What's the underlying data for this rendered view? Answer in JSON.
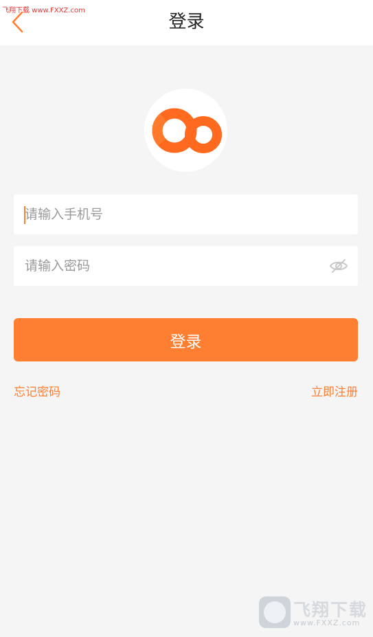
{
  "watermark": {
    "top_text": "飞翔下载 www.FXXZ.com",
    "bottom_name": "飞翔下载",
    "bottom_site": "www.FXXZ.com"
  },
  "header": {
    "title": "登录",
    "back_icon": "chevron-left-icon"
  },
  "logo": {
    "icon": "app-logo",
    "color": "#ff6a1f"
  },
  "form": {
    "phone_placeholder": "请输入手机号",
    "phone_value": "",
    "password_placeholder": "请输入密码",
    "password_value": "",
    "password_toggle_icon": "eye-hidden-icon",
    "submit_label": "登录"
  },
  "links": {
    "forgot_password": "忘记密码",
    "register": "立即注册"
  },
  "colors": {
    "accent": "#ff7f32",
    "background": "#f5f5f5",
    "surface": "#ffffff"
  }
}
